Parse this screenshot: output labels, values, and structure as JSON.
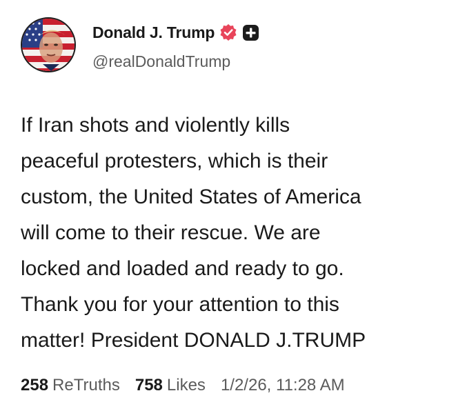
{
  "post": {
    "author": {
      "display_name": "Donald J. Trump",
      "handle": "@realDonaldTrump",
      "verified_icon": "verified-badge-icon",
      "plus_icon": "plus-badge-icon",
      "verified_color": "#e8445a",
      "plus_color": "#1c1c1c"
    },
    "text_lines": [
      "If Iran shots and violently kills",
      "peaceful protesters, which is their",
      "custom, the United States of America",
      "will come to their rescue. We are",
      "locked and loaded and ready to go.",
      "Thank you for your attention to this",
      "matter! President DONALD J.TRUMP"
    ],
    "stats": {
      "retruths_count": "258",
      "retruths_label": "ReTruths",
      "likes_count": "758",
      "likes_label": "Likes",
      "timestamp": "1/2/26, 11:28 AM"
    }
  }
}
